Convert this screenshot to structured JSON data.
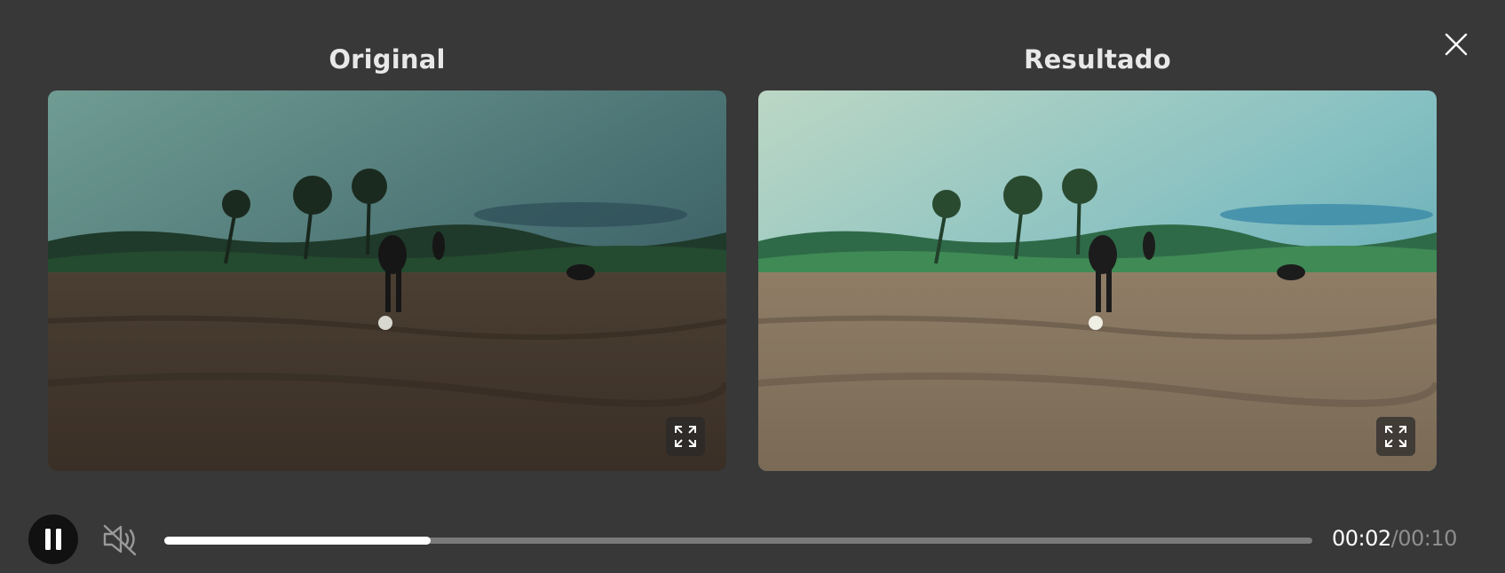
{
  "panels": {
    "original": {
      "title": "Original"
    },
    "result": {
      "title": "Resultado"
    }
  },
  "player": {
    "state": "playing",
    "muted": true,
    "current_time": "00:02",
    "separator": "/",
    "duration": "00:10",
    "progress": 0.232
  },
  "icons": {
    "close": "close-icon",
    "fullscreen": "fullscreen-icon",
    "pause": "pause-icon",
    "mute": "volume-muted-icon"
  },
  "colors": {
    "background": "#383838",
    "title_text": "#e8e8e8",
    "progress_track": "#7a7a7a",
    "progress_fill": "#ffffff",
    "duration_text": "#8e8e8e"
  }
}
